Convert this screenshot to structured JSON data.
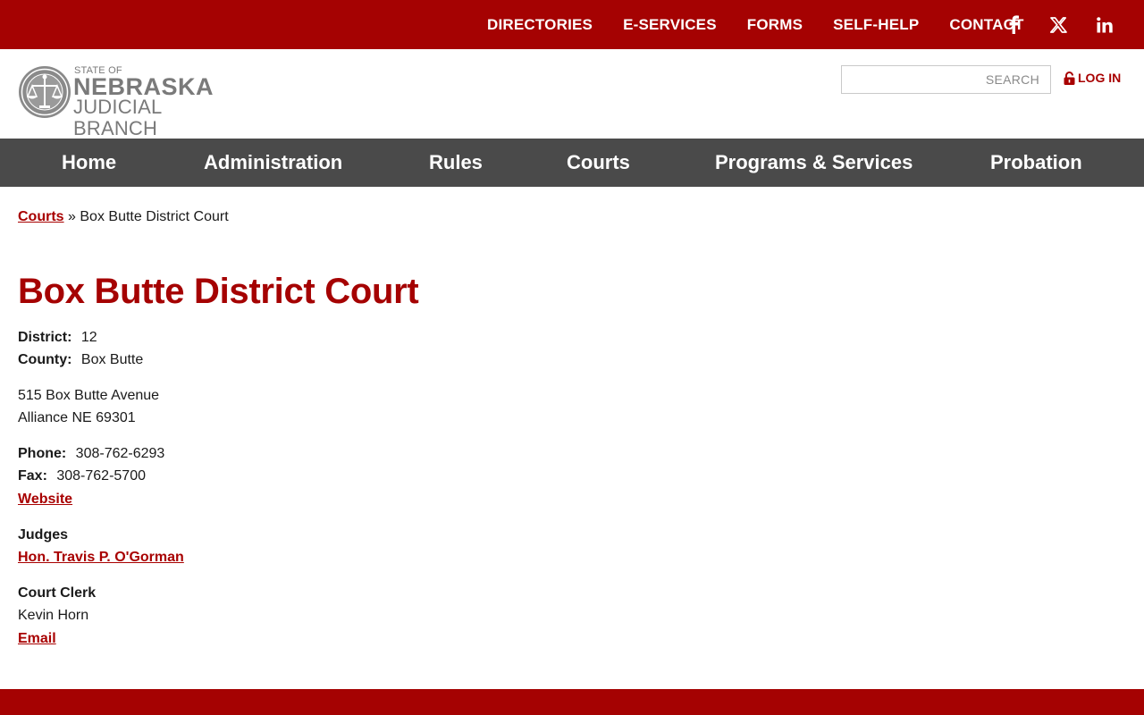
{
  "top_nav": {
    "items": [
      "DIRECTORIES",
      "E-SERVICES",
      "FORMS",
      "SELF-HELP",
      "CONTACT"
    ],
    "social": [
      "facebook-icon",
      "x-twitter-icon",
      "linkedin-icon"
    ]
  },
  "logo": {
    "line1": "STATE OF",
    "line2": "NEBRASKA",
    "line3": "JUDICIAL BRANCH"
  },
  "search": {
    "placeholder": "SEARCH",
    "value": ""
  },
  "login": {
    "label": "LOG IN",
    "icon": "lock-icon"
  },
  "main_nav": {
    "items": [
      "Home",
      "Administration",
      "Rules",
      "Courts",
      "Programs & Services",
      "Probation"
    ]
  },
  "breadcrumb": {
    "parent": "Courts",
    "separator": "»",
    "current": "Box Butte District Court"
  },
  "page": {
    "title": "Box Butte District Court",
    "district_label": "District:",
    "district_value": "12",
    "county_label": "County:",
    "county_value": "Box Butte",
    "address_line1": "515 Box Butte Avenue",
    "address_line2": "Alliance NE 69301",
    "phone_label": "Phone:",
    "phone_value": "308-762-6293",
    "fax_label": "Fax:",
    "fax_value": "308-762-5700",
    "website_link": "Website",
    "judges_heading": "Judges",
    "judge_name": "Hon. Travis P. O'Gorman",
    "clerk_heading": "Court Clerk",
    "clerk_name": "Kevin Horn",
    "email_link": "Email"
  },
  "colors": {
    "brand_red": "#a50202",
    "nav_gray": "#4a4a4a",
    "link_red": "#a80000"
  }
}
